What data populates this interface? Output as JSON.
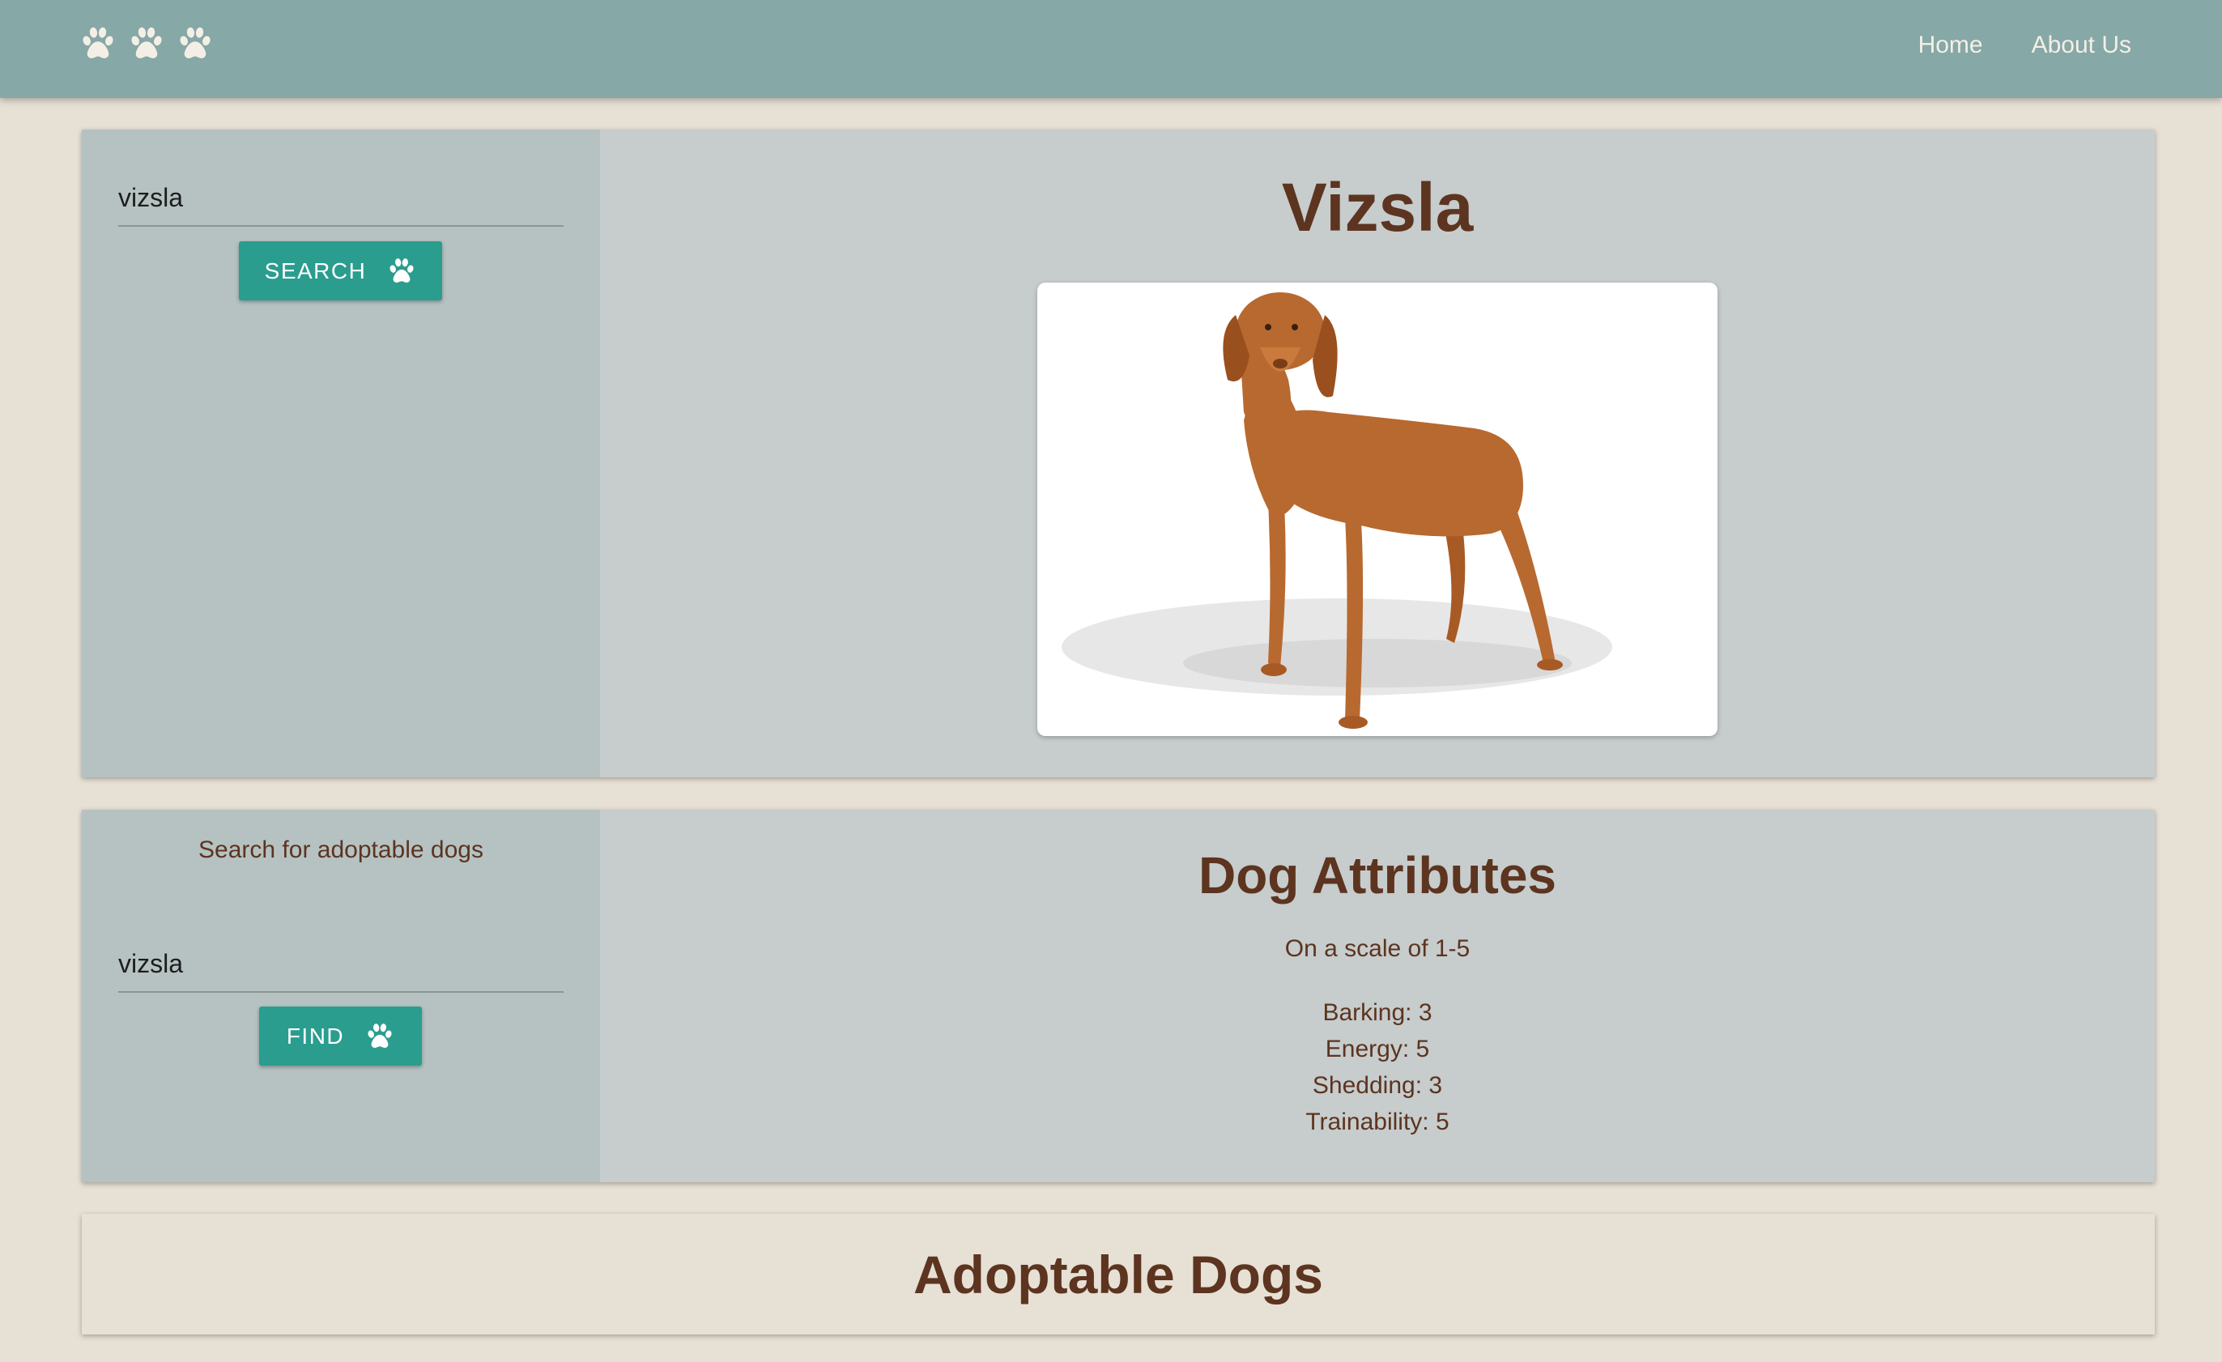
{
  "nav": {
    "logo_icons": [
      "paw-icon",
      "paw-icon",
      "paw-icon"
    ],
    "links": [
      {
        "label": "Home"
      },
      {
        "label": "About Us"
      }
    ]
  },
  "breed_search": {
    "input_value": "vizsla",
    "button_label": "SEARCH",
    "button_icon": "paw-icon"
  },
  "breed_detail": {
    "name": "Vizsla",
    "image": "vizsla-dog-photo"
  },
  "adoption_search": {
    "prompt": "Search for adoptable dogs",
    "input_value": "vizsla",
    "button_label": "FIND",
    "button_icon": "paw-icon"
  },
  "attributes": {
    "title": "Dog Attributes",
    "subtitle": "On a scale of 1-5",
    "items": [
      {
        "label": "Barking: 3"
      },
      {
        "label": "Energy: 5"
      },
      {
        "label": "Shedding: 3"
      },
      {
        "label": "Trainability: 5"
      }
    ]
  },
  "adoptable": {
    "title": "Adoptable Dogs"
  },
  "colors": {
    "navbar": "#86a8a6",
    "page_background": "#e7e0d5",
    "button": "#2a9d8f",
    "heading_text": "#5c3420"
  }
}
